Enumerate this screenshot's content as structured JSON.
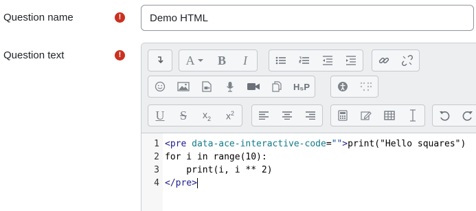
{
  "form": {
    "question_name_label": "Question name",
    "question_name_value": "Demo HTML",
    "question_text_label": "Question text",
    "required_mark": "!"
  },
  "toolbar": {
    "row1": [
      "collapse",
      "font-color",
      "bold",
      "italic",
      "unordered-list",
      "ordered-list",
      "outdent",
      "indent",
      "link",
      "unlink"
    ],
    "row2": [
      "emoji",
      "image",
      "media",
      "record-audio",
      "record-video",
      "manage-files",
      "h5p",
      "accessibility-checker",
      "screenreader-helper"
    ],
    "row3": [
      "underline",
      "strikethrough",
      "subscript",
      "superscript",
      "align-left",
      "align-center",
      "align-right",
      "equation",
      "special-character",
      "table",
      "clear-formatting",
      "undo",
      "redo"
    ],
    "labels": {
      "bold": "B",
      "italic": "I",
      "font_a": "A",
      "underline": "U",
      "strike": "S",
      "sub": "x",
      "sub_2": "2",
      "sup": "x",
      "sup_2": "2",
      "h5p": "H₅P"
    }
  },
  "code_editor": {
    "line_numbers": [
      "1",
      "2",
      "3",
      "4"
    ],
    "lines": {
      "l1_tag_open": "<pre ",
      "l1_attr": "data-ace-interactive-code",
      "l1_eq": "=",
      "l1_str": "\"\"",
      "l1_close": ">",
      "l1_text": "print(\"Hello squares\")",
      "l2": "for i in range(10):",
      "l3": "    print(i, i ** 2)",
      "l4": "</pre>"
    }
  }
}
